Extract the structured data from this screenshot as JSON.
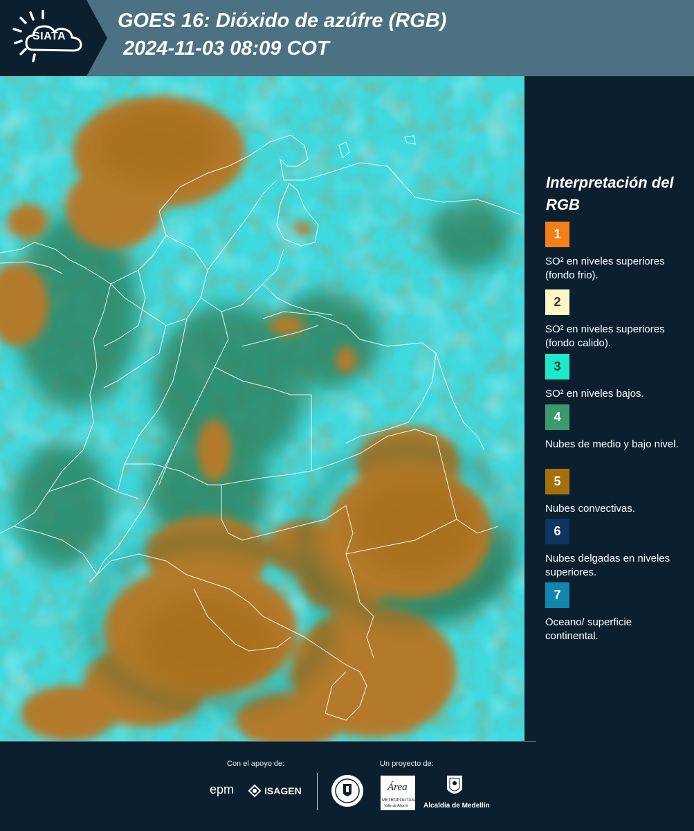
{
  "header": {
    "logo_text": "SIATA",
    "title_line1": "GOES 16: Dióxido de azúfre (RGB)",
    "title_line2": "2024-11-03 08:09 COT"
  },
  "legend": {
    "title": "Interpretación del RGB",
    "items": [
      {
        "number": "1",
        "color": "#f57f17",
        "text_color": "#ffffff",
        "description": "SO² en niveles superiores (fondo frio)."
      },
      {
        "number": "2",
        "color": "#fdf6c4",
        "text_color": "#333333",
        "description": "SO² en niveles superiores (fondo calido)."
      },
      {
        "number": "3",
        "color": "#1de9c9",
        "text_color": "#0f4a44",
        "description": "SO² en niveles bajos."
      },
      {
        "number": "4",
        "color": "#3a9a6d",
        "text_color": "#ffffff",
        "description": "Nubes de medio y bajo nivel."
      },
      {
        "number": "5",
        "color": "#a5700a",
        "text_color": "#ffffff",
        "description": "Nubes convectivas."
      },
      {
        "number": "6",
        "color": "#0c3561",
        "text_color": "#ffffff",
        "description": "Nubes delgadas en niveles superiores."
      },
      {
        "number": "7",
        "color": "#1187b0",
        "text_color": "#ffffff",
        "description": "Oceano/ superficie continental."
      }
    ]
  },
  "footer": {
    "support_label": "Con el apoyo de:",
    "project_label": "Un proyecto de:",
    "sponsor_epm": "epm",
    "sponsor_isagen": "ISAGEN",
    "area_text": "Área",
    "area_sub1": "METROPOLITANA",
    "area_sub2": "Valle de Aburrá",
    "alcaldia": "Alcaldía de Medellín"
  },
  "map": {
    "colors": {
      "cyan_low_so2": "#36e3e6",
      "green_mid_clouds": "#2f7a55",
      "brown_convective": "#b17a2c",
      "border_lines": "#ffffff"
    }
  }
}
